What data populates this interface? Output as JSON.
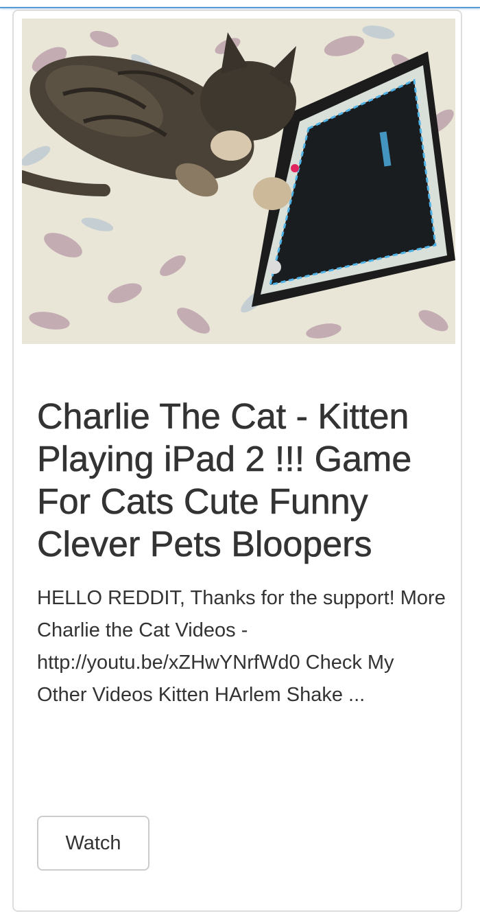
{
  "card": {
    "thumbnail_alt": "kitten playing with iPad",
    "title": "Charlie The Cat - Kitten Playing iPad 2 !!! Game For Cats Cute Funny Clever Pets Bloopers",
    "description": "HELLO REDDIT, Thanks for the support! More Charlie the Cat Videos - http://youtu.be/xZHwYNrfWd0 Check My Other Videos Kitten HArlem Shake ...",
    "watch_label": "Watch"
  },
  "colors": {
    "accent_rule": "#5b9bd5",
    "text": "#333333",
    "card_border": "#dddddd",
    "button_border": "#cccccc"
  }
}
